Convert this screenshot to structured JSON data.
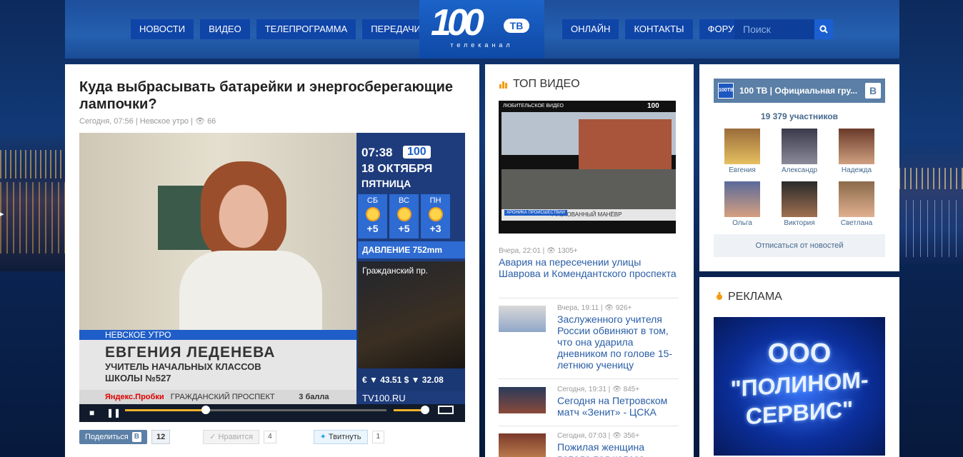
{
  "nav_left": [
    "Новости",
    "Видео",
    "Телепрограмма",
    "Передачи"
  ],
  "nav_right": [
    "Онлайн",
    "Контакты",
    "Форум"
  ],
  "logo": {
    "main": "100",
    "tv": "ТВ",
    "sub": "телеканал"
  },
  "search": {
    "placeholder": "Поиск"
  },
  "article": {
    "title": "Куда выбрасывать батарейки и энергосберегающие лампочки?",
    "meta": "Сегодня, 07:56 | Невское утро |",
    "views": "66",
    "video": {
      "time": "07:38",
      "channel_badge": "100",
      "date": "18 ОКТЯБРЯ",
      "day": "ПЯТНИЦА",
      "weather": [
        {
          "day": "СБ",
          "temp": "+5"
        },
        {
          "day": "ВС",
          "temp": "+5"
        },
        {
          "day": "ПН",
          "temp": "+3"
        }
      ],
      "pressure": "ДАВЛЕНИЕ 752mm",
      "street": "Гражданский пр.",
      "show_tag": "НЕВСКОЕ УТРО",
      "name": "ЕВГЕНИЯ ЛЕДЕНЕВА",
      "role1": "УЧИТЕЛЬ НАЧАЛЬНЫХ КЛАССОВ",
      "role2": "ШКОЛЫ №527",
      "ticker_brand": "Яндекс.Пробки",
      "ticker_text": "ГРАЖДАНСКИЙ ПРОСПЕКТ",
      "ticker_score": "3 балла",
      "rates": "€ ▼ 43.51  $ ▼ 32.08",
      "url": "TV100.RU",
      "progress": 0.31
    },
    "share": {
      "vk_label": "Поделиться",
      "vk_b": "В",
      "vk_count": "12",
      "like_label": "Нравится",
      "like_count": "4",
      "tw_label": "Твитнуть",
      "tw_count": "1"
    }
  },
  "top_video": {
    "title": "Топ видео",
    "thumb": {
      "top_label": "ЛЮБИТЕЛЬСКОЕ ВИДЕО",
      "top_right": "100",
      "cat": "ХРОНИКА ПРОИСШЕСТВИЙ",
      "caption": "РИСКОВАННЫЙ МАНЁВР"
    },
    "items": [
      {
        "meta": "Вчера, 22:01 |",
        "views": "1305+",
        "text": "Авария на пересечении улицы Шаврова и Комендантского проспекта"
      },
      {
        "meta": "Вчера, 19:11 |",
        "views": "926+",
        "text": "Заслуженного учителя России обвиняют в том, что она ударила дневником по голове 15-летнюю ученицу"
      },
      {
        "meta": "Сегодня, 19:31 |",
        "views": "845+",
        "text": "Сегодня на Петровском матч «Зенит» - ЦСКА"
      },
      {
        "meta": "Сегодня, 07:03 |",
        "views": "356+",
        "text": "Пожилая женщина попала под колеса"
      }
    ]
  },
  "vk": {
    "title": "100 ТВ | Официальная гру...",
    "logo_text": "100ТВ",
    "b": "В",
    "members_count": "19 379 участников",
    "members": [
      "Евгения",
      "Александр",
      "Надежда",
      "Ольга",
      "Виктория",
      "Светлана"
    ],
    "unsubscribe": "Отписаться от новостей"
  },
  "ad": {
    "title": "Реклама",
    "line1": "ООО",
    "line2": "\"ПОЛИНОМ-",
    "line3": "СЕРВИС\""
  },
  "colors": {
    "accent": "#1b5fd0",
    "nav_bg": "#1045a8",
    "link": "#2a5ea6",
    "vk": "#5b7fa6"
  }
}
